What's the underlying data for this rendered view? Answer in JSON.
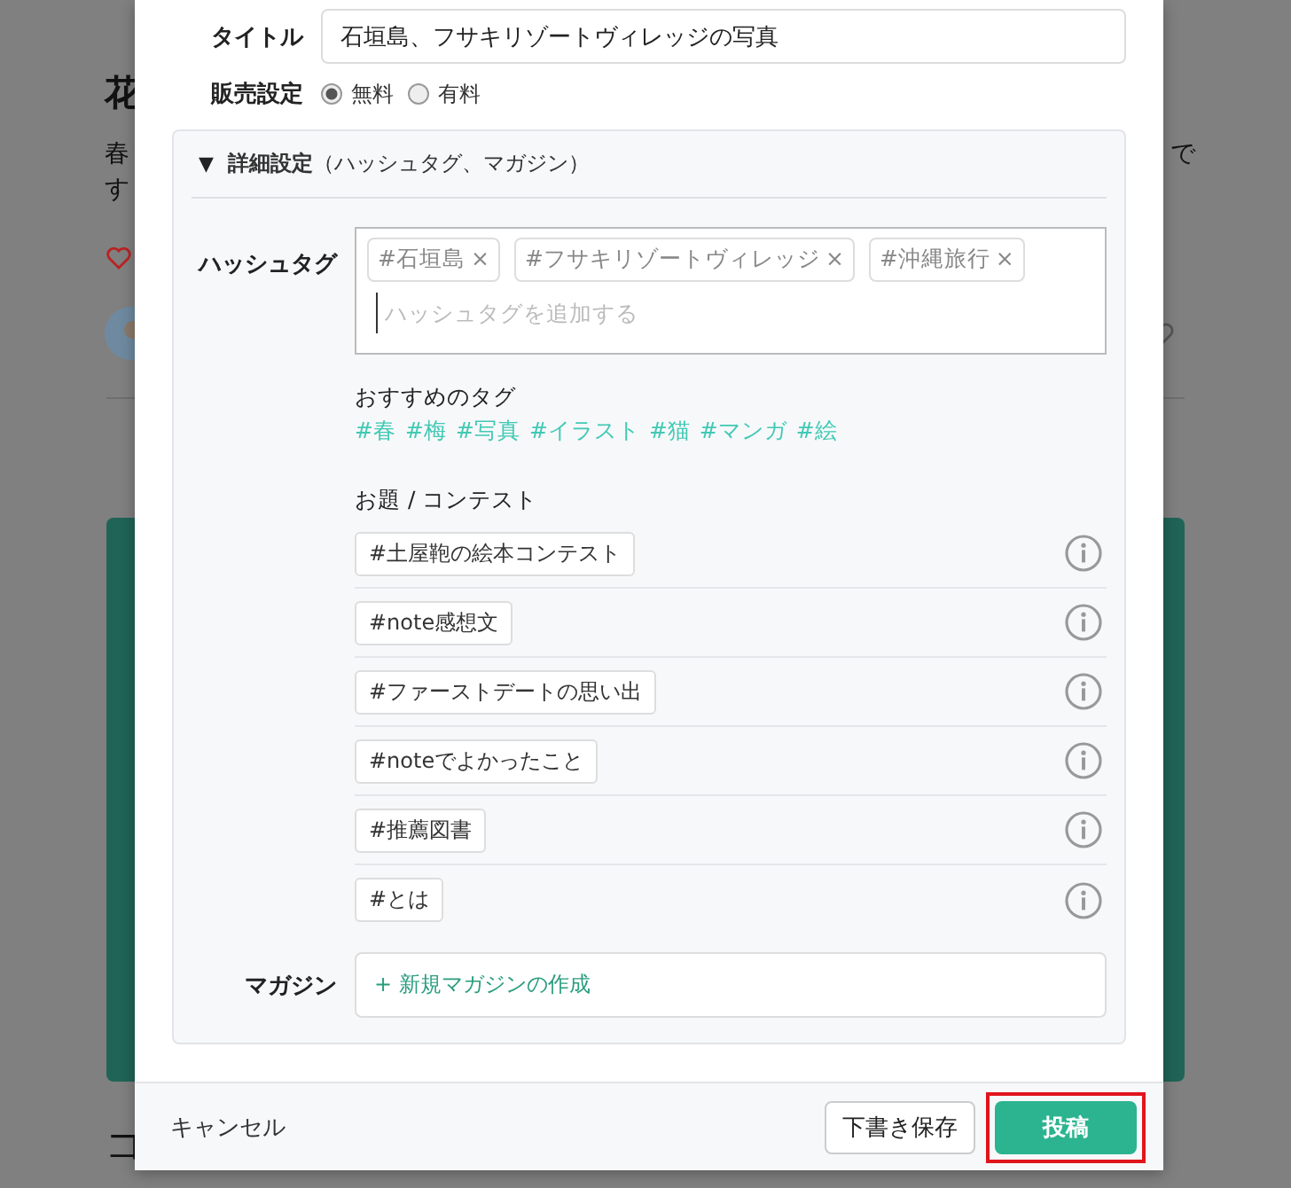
{
  "background": {
    "heading": "花",
    "text_left": [
      "春",
      "す"
    ],
    "text_right": "で",
    "bottom_heading": "コ"
  },
  "form": {
    "title_label": "タイトル",
    "title_value": "石垣島、フサキリゾートヴィレッジの写真",
    "sales_label": "販売設定",
    "sales_options": [
      {
        "label": "無料",
        "selected": true
      },
      {
        "label": "有料",
        "selected": false
      }
    ]
  },
  "details": {
    "toggle": "▼",
    "title": "詳細設定",
    "subtitle": "（ハッシュタグ、マガジン）",
    "expanded": true,
    "hashtag_label": "ハッシュタグ",
    "hashtags": [
      {
        "label": "#石垣島",
        "remove": "×"
      },
      {
        "label": "#フサキリゾートヴィレッジ",
        "remove": "×"
      },
      {
        "label": "#沖縄旅行",
        "remove": "×"
      }
    ],
    "hashtag_placeholder": "ハッシュタグを追加する",
    "recommended_label": "おすすめのタグ",
    "recommended": [
      "#春",
      "#梅",
      "#写真",
      "#イラスト",
      "#猫",
      "#マンガ",
      "#絵"
    ],
    "contest_label": "お題 / コンテスト",
    "contests": [
      "#土屋鞄の絵本コンテスト",
      "#note感想文",
      "#ファーストデートの思い出",
      "#noteでよかったこと",
      "#推薦図書",
      "#とは"
    ],
    "magazine_label": "マガジン",
    "magazine_link": "+ 新規マガジンの作成"
  },
  "footer": {
    "cancel": "キャンセル",
    "draft": "下書き保存",
    "post": "投稿",
    "post_highlighted": true
  }
}
